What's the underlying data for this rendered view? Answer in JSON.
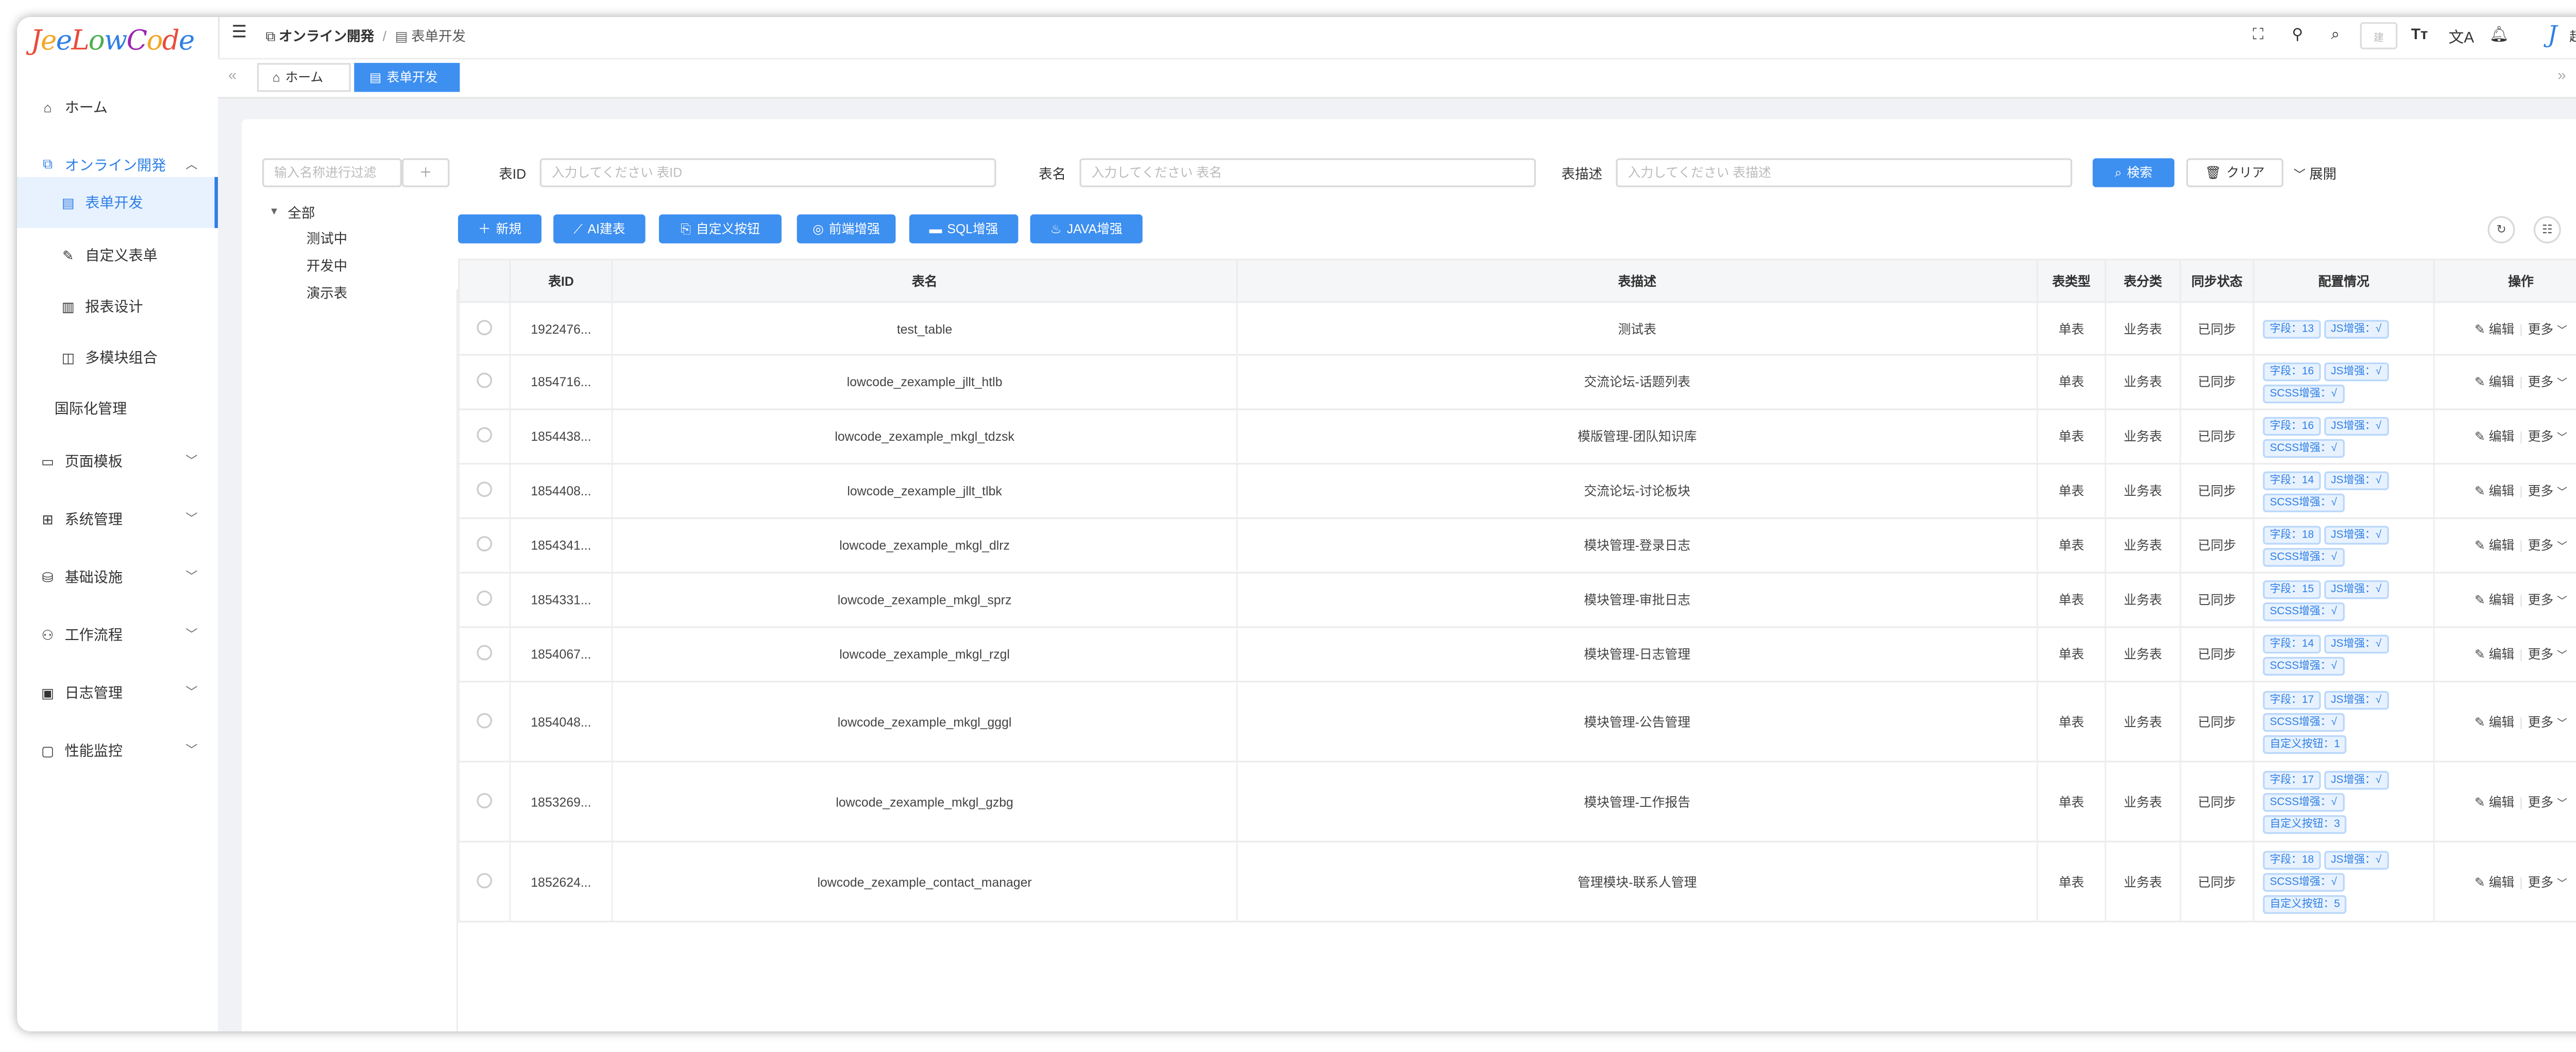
{
  "app": {
    "logo": "JeeLowCode"
  },
  "sidebar": {
    "items": [
      {
        "label": "ホーム",
        "icon": "home-icon"
      },
      {
        "label": "オンライン開発",
        "icon": "online-dev-icon"
      },
      {
        "label": "表单开发",
        "icon": "form-dev-icon"
      },
      {
        "label": "自定义表单",
        "icon": "custom-form-icon"
      },
      {
        "label": "报表设计",
        "icon": "report-design-icon"
      },
      {
        "label": "多模块组合",
        "icon": "multi-module-icon"
      },
      {
        "label": "国际化管理",
        "icon": ""
      },
      {
        "label": "页面模板",
        "icon": "page-template-icon"
      },
      {
        "label": "系统管理",
        "icon": "system-icon"
      },
      {
        "label": "基础设施",
        "icon": "infra-icon"
      },
      {
        "label": "工作流程",
        "icon": "workflow-icon"
      },
      {
        "label": "日志管理",
        "icon": "log-icon"
      },
      {
        "label": "性能监控",
        "icon": "monitor-icon"
      }
    ]
  },
  "header": {
    "breadcrumb_parent": "オンライン開発",
    "breadcrumb_sep": "/",
    "breadcrumb_current": "表单开发",
    "search_placeholder": "建",
    "user_name": "超级管理员"
  },
  "tabs": [
    {
      "label": "ホーム"
    },
    {
      "label": "表单开发"
    }
  ],
  "filter": {
    "tree_search_placeholder": "输入名称进行过滤",
    "table_id_label": "表ID",
    "table_id_placeholder": "入力してください 表ID",
    "table_name_label": "表名",
    "table_name_placeholder": "入力してください 表名",
    "table_desc_label": "表描述",
    "table_desc_placeholder": "入力してください 表描述",
    "search_label": "検索",
    "clear_label": "クリア",
    "expand_label": "展開"
  },
  "tree": {
    "root": "全部",
    "children": [
      "测试中",
      "开发中",
      "演示表"
    ]
  },
  "toolbar": {
    "new_label": "新規",
    "ai_label": "AI建表",
    "custom_btn_label": "自定义按钮",
    "frontend_label": "前端增强",
    "sql_label": "SQL增强",
    "java_label": "JAVA增强"
  },
  "table": {
    "headers": [
      "表ID",
      "表名",
      "表描述",
      "表类型",
      "表分类",
      "同步状态",
      "配置情况",
      "操作"
    ],
    "edit_label": "编辑",
    "more_label": "更多",
    "rows": [
      {
        "id": "1922476...",
        "name": "test_table",
        "desc": "测试表",
        "type": "单表",
        "category": "业务表",
        "sync": "已同步",
        "tags": [
          "字段：13",
          "JS增强：√"
        ]
      },
      {
        "id": "1854716...",
        "name": "lowcode_zexample_jllt_htlb",
        "desc": "交流论坛-话题列表",
        "type": "单表",
        "category": "业务表",
        "sync": "已同步",
        "tags": [
          "字段：16",
          "JS增强：√",
          "SCSS增强：√"
        ]
      },
      {
        "id": "1854438...",
        "name": "lowcode_zexample_mkgl_tdzsk",
        "desc": "模版管理-团队知识库",
        "type": "单表",
        "category": "业务表",
        "sync": "已同步",
        "tags": [
          "字段：16",
          "JS增强：√",
          "SCSS增强：√"
        ]
      },
      {
        "id": "1854408...",
        "name": "lowcode_zexample_jllt_tlbk",
        "desc": "交流论坛-讨论板块",
        "type": "单表",
        "category": "业务表",
        "sync": "已同步",
        "tags": [
          "字段：14",
          "JS增强：√",
          "SCSS增强：√"
        ]
      },
      {
        "id": "1854341...",
        "name": "lowcode_zexample_mkgl_dlrz",
        "desc": "模块管理-登录日志",
        "type": "单表",
        "category": "业务表",
        "sync": "已同步",
        "tags": [
          "字段：18",
          "JS增强：√",
          "SCSS增强：√"
        ]
      },
      {
        "id": "1854331...",
        "name": "lowcode_zexample_mkgl_sprz",
        "desc": "模块管理-审批日志",
        "type": "单表",
        "category": "业务表",
        "sync": "已同步",
        "tags": [
          "字段：15",
          "JS增强：√",
          "SCSS增强：√"
        ]
      },
      {
        "id": "1854067...",
        "name": "lowcode_zexample_mkgl_rzgl",
        "desc": "模块管理-日志管理",
        "type": "单表",
        "category": "业务表",
        "sync": "已同步",
        "tags": [
          "字段：14",
          "JS增强：√",
          "SCSS增强：√"
        ]
      },
      {
        "id": "1854048...",
        "name": "lowcode_zexample_mkgl_gggl",
        "desc": "模块管理-公告管理",
        "type": "单表",
        "category": "业务表",
        "sync": "已同步",
        "tags": [
          "字段：17",
          "JS增强：√",
          "SCSS增强：√",
          "自定义按钮：1"
        ]
      },
      {
        "id": "1853269...",
        "name": "lowcode_zexample_mkgl_gzbg",
        "desc": "模块管理-工作报告",
        "type": "单表",
        "category": "业务表",
        "sync": "已同步",
        "tags": [
          "字段：17",
          "JS增强：√",
          "SCSS增强：√",
          "自定义按钮：3"
        ]
      },
      {
        "id": "1852624...",
        "name": "lowcode_zexample_contact_manager",
        "desc": "管理模块-联系人管理",
        "type": "单表",
        "category": "业务表",
        "sync": "已同步",
        "tags": [
          "字段：18",
          "JS增强：√",
          "SCSS增强：√",
          "自定义按钮：5"
        ]
      }
    ]
  },
  "colors": {
    "accent": "#3d8ff0",
    "sync": "#52c41a",
    "link": "#2f7fe5"
  }
}
